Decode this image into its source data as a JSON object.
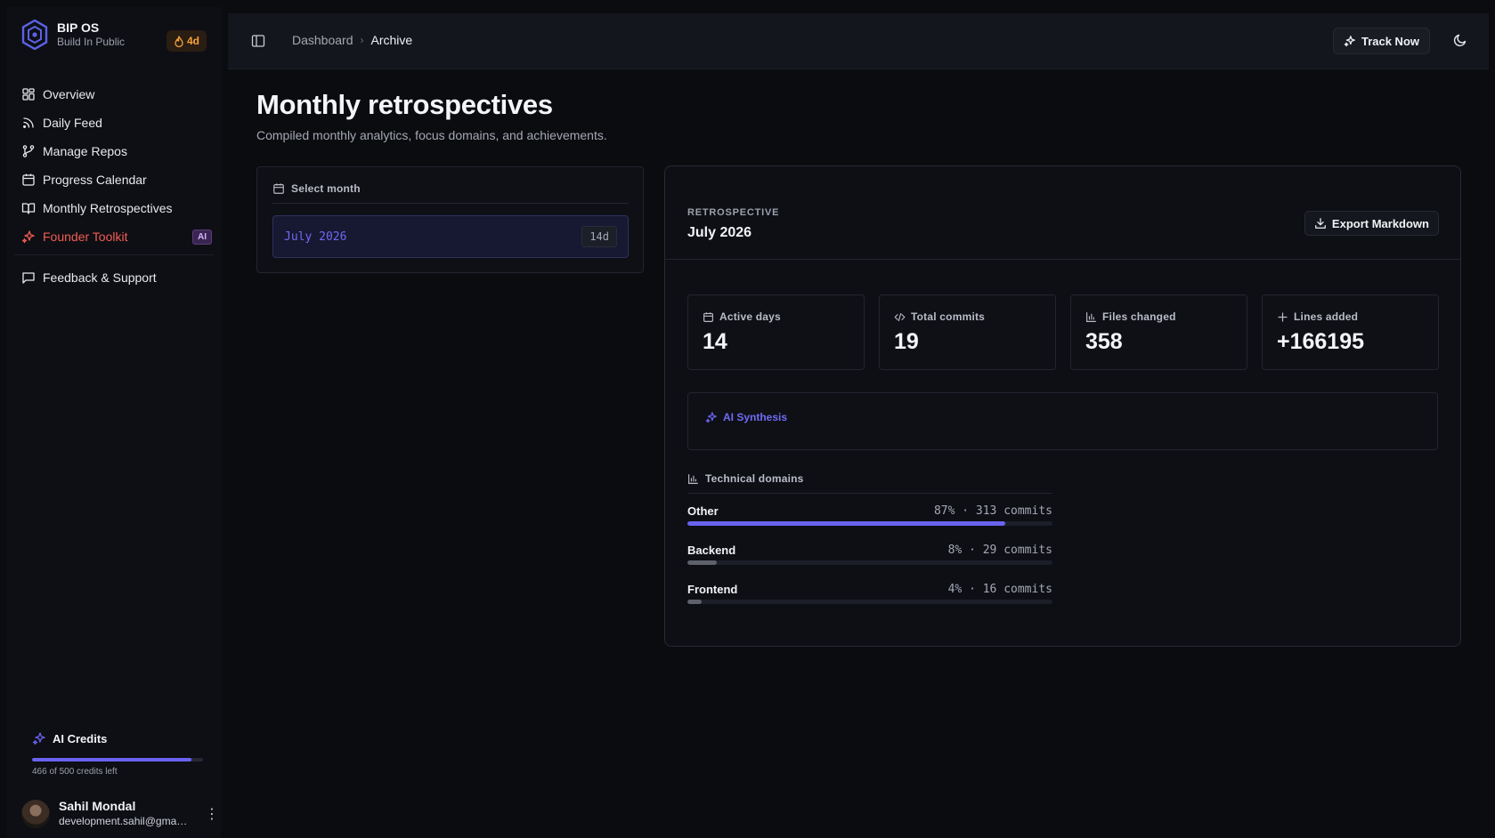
{
  "brand": {
    "title": "BIP OS",
    "subtitle": "Build In Public",
    "streak": "4d"
  },
  "sidebar": {
    "items": [
      {
        "label": "Overview",
        "icon": "grid-icon"
      },
      {
        "label": "Daily Feed",
        "icon": "rss-icon"
      },
      {
        "label": "Manage Repos",
        "icon": "git-branch-icon"
      },
      {
        "label": "Progress Calendar",
        "icon": "calendar-icon"
      },
      {
        "label": "Monthly Retrospectives",
        "icon": "book-open-icon"
      },
      {
        "label": "Founder Toolkit",
        "icon": "sparkles-icon",
        "badge": "AI"
      }
    ],
    "secondary": [
      {
        "label": "Feedback & Support",
        "icon": "message-square-icon"
      }
    ]
  },
  "credits": {
    "title": "AI Credits",
    "text": "466 of 500 credits left",
    "used_fraction": 0.932
  },
  "user": {
    "name": "Sahil Mondal",
    "email": "development.sahil@gmail.com"
  },
  "topbar": {
    "breadcrumb": [
      "Dashboard",
      "Archive"
    ],
    "track_label": "Track Now"
  },
  "page": {
    "title": "Monthly retrospectives",
    "subtitle": "Compiled monthly analytics, focus domains, and achievements."
  },
  "month_picker": {
    "title": "Select month",
    "options": [
      {
        "label": "July 2026",
        "days": "14d"
      }
    ]
  },
  "retrospective": {
    "label": "RETROSPECTIVE",
    "month": "July 2026",
    "export_label": "Export Markdown",
    "stats": [
      {
        "label": "Active days",
        "value": "14",
        "icon": "calendar-icon"
      },
      {
        "label": "Total commits",
        "value": "19",
        "icon": "code-icon"
      },
      {
        "label": "Files changed",
        "value": "358",
        "icon": "bar-chart-icon"
      },
      {
        "label": "Lines added",
        "value": "+166195",
        "icon": "plus-icon"
      }
    ],
    "ai_title": "AI Synthesis",
    "domains_title": "Technical domains",
    "domains": [
      {
        "name": "Other",
        "stats": "87% · 313 commits",
        "percent": 87,
        "color": "#6a63f0"
      },
      {
        "name": "Backend",
        "stats": "8% · 29 commits",
        "percent": 8,
        "color": "#5e616c"
      },
      {
        "name": "Frontend",
        "stats": "4% · 16 commits",
        "percent": 4,
        "color": "#5e616c"
      }
    ]
  },
  "colors": {
    "accent": "#6a63f0",
    "streak": "#f5a13a",
    "founder": "#f25c54"
  }
}
